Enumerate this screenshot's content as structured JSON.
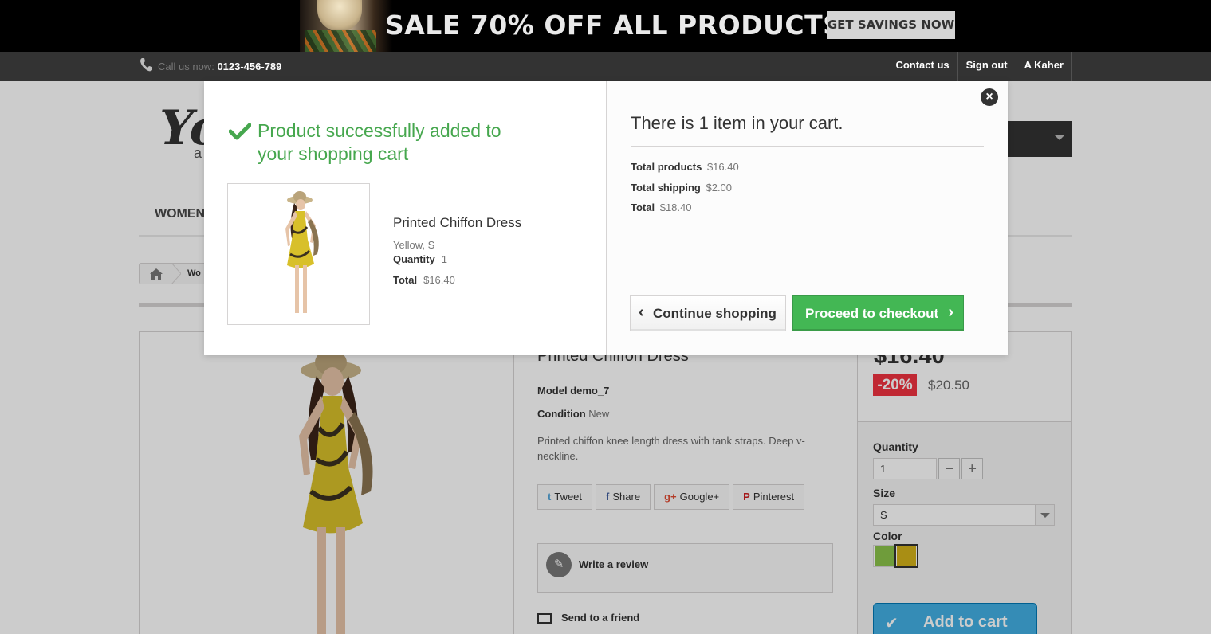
{
  "banner": {
    "headline": "SALE 70% OFF ALL PRODUCTS",
    "cta": "GET SAVINGS NOW"
  },
  "nav": {
    "call_label": "Call us now:",
    "phone": "0123-456-789",
    "links": [
      "Contact us",
      "Sign out",
      "A Kaher"
    ]
  },
  "header": {
    "logo_text": "Yo",
    "logo_sub": "a"
  },
  "menu": {
    "first_item": "WOMEN"
  },
  "breadcrumb": {
    "item": "Wo"
  },
  "product": {
    "title": "Printed Chiffon Dress",
    "model_label": "Model",
    "model_value": "demo_7",
    "condition_label": "Condition",
    "condition_value": "New",
    "description": "Printed chiffon knee length dress with tank straps. Deep v-neckline.",
    "social": [
      {
        "icon": "twitter-icon",
        "label": "Tweet"
      },
      {
        "icon": "facebook-icon",
        "label": "Share"
      },
      {
        "icon": "google-plus-icon",
        "label": "Google+"
      },
      {
        "icon": "pinterest-icon",
        "label": "Pinterest"
      }
    ],
    "review_label": "Write a review",
    "friend_label": "Send to a friend"
  },
  "buybox": {
    "price": "$16.40",
    "discount": "-20%",
    "old_price": "$20.50",
    "quantity_label": "Quantity",
    "quantity_value": "1",
    "size_label": "Size",
    "size_value": "S",
    "color_label": "Color",
    "colors": [
      "#8bc34a",
      "#d4b21a"
    ],
    "add_to_cart": "Add to cart"
  },
  "modal": {
    "success_msg": "Product successfully added to your shopping cart",
    "product_name": "Printed Chiffon Dress",
    "product_attrs": "Yellow, S",
    "quantity_label": "Quantity",
    "quantity_value": "1",
    "total_label": "Total",
    "total_value": "$16.40",
    "cart_count_msg": "There is 1 item in your cart.",
    "summary": {
      "products_label": "Total products",
      "products_value": "$16.40",
      "shipping_label": "Total shipping",
      "shipping_value": "$2.00",
      "total_label": "Total",
      "total_value": "$18.40"
    },
    "continue_label": "Continue shopping",
    "checkout_label": "Proceed to checkout"
  },
  "colors": {
    "success_green": "#46a74e",
    "checkout_green": "#43b754",
    "discount_red": "#f13340",
    "cart_blue": "#43b0e4"
  }
}
